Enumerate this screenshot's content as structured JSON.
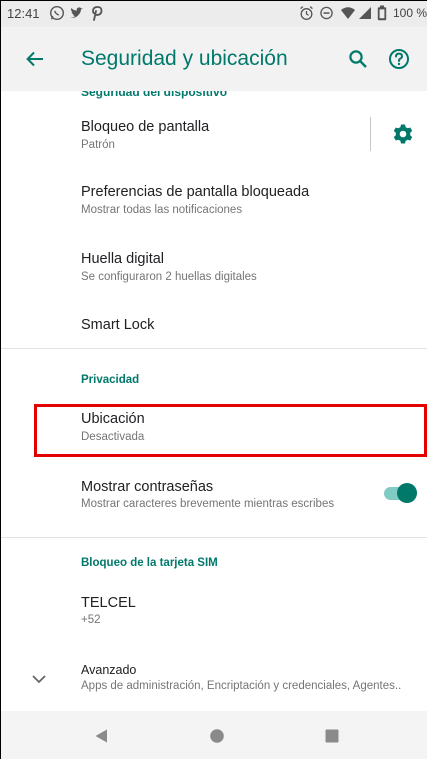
{
  "status_bar": {
    "time": "12:41",
    "battery": "100 %",
    "left_icons": [
      "whatsapp-icon",
      "twitter-icon",
      "pinterest-icon"
    ],
    "right_icons": [
      "alarm-icon",
      "do-not-disturb-icon",
      "wifi-icon",
      "signal-icon",
      "battery-icon"
    ]
  },
  "app_bar": {
    "title": "Seguridad y ubicación",
    "back_icon": "arrow-back-icon",
    "search_icon": "search-icon",
    "help_icon": "help-icon",
    "accent": "#00796b"
  },
  "list": {
    "cut_header": "Seguridad del dispositivo",
    "screen_lock": {
      "title": "Bloqueo de pantalla",
      "summary": "Patrón",
      "settings_icon": "gear-icon"
    },
    "lock_prefs": {
      "title": "Preferencias de pantalla bloqueada",
      "summary": "Mostrar todas las notificaciones"
    },
    "fingerprint": {
      "title": "Huella digital",
      "summary": "Se configuraron 2 huellas digitales"
    },
    "smart_lock": {
      "title": "Smart Lock"
    },
    "privacy_header": "Privacidad",
    "location": {
      "title": "Ubicación",
      "summary": "Desactivada",
      "highlight_color": "#e50000"
    },
    "show_passwords": {
      "title": "Mostrar contraseñas",
      "summary": "Mostrar caracteres brevemente mientras escribes",
      "toggle_on": true
    },
    "sim_header": "Bloqueo de la tarjeta SIM",
    "carrier": {
      "title": "TELCEL",
      "summary": "+52"
    },
    "advanced": {
      "title": "Avanzado",
      "summary": "Apps de administración, Encriptación y credenciales, Agentes..",
      "chevron_icon": "chevron-down-icon"
    }
  },
  "nav_bar": {
    "back_icon": "nav-back-icon",
    "home_icon": "nav-home-icon",
    "recents_icon": "nav-recents-icon"
  }
}
